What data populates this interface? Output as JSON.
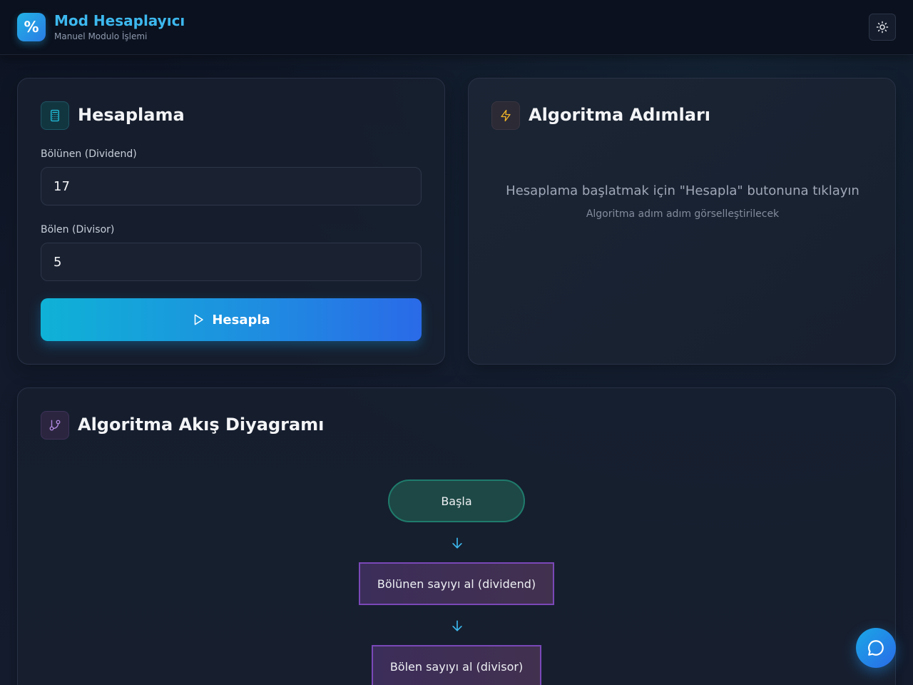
{
  "header": {
    "logo_symbol": "%",
    "title": "Mod Hesaplayıcı",
    "subtitle": "Manuel Modulo İşlemi",
    "theme_toggle_icon": "sun-icon"
  },
  "calculator": {
    "title": "Hesaplama",
    "icon": "calculator-icon",
    "dividend_label": "Bölünen (Dividend)",
    "dividend_value": "17",
    "divisor_label": "Bölen (Divisor)",
    "divisor_value": "5",
    "button_label": "Hesapla",
    "button_icon": "play-icon"
  },
  "steps": {
    "title": "Algoritma Adımları",
    "icon": "lightning-icon",
    "empty_message": "Hesaplama başlatmak için \"Hesapla\" butonuna tıklayın",
    "empty_sub": "Algoritma adım adım görselleştirilecek"
  },
  "flowchart": {
    "title": "Algoritma Akış Diyagramı",
    "icon": "git-branch-icon",
    "nodes": [
      {
        "label": "Başla",
        "type": "start"
      },
      {
        "label": "Bölünen sayıyı al (dividend)",
        "type": "process"
      },
      {
        "label": "Bölen sayıyı al (divisor)",
        "type": "process"
      }
    ]
  },
  "chat": {
    "icon": "chat-bubble-icon"
  },
  "colors": {
    "accent": "#3db8ee",
    "button_gradient_start": "#0fb2d6",
    "button_gradient_end": "#2a6ae8",
    "start_node": "#1d4845",
    "process_node_border": "#7a48b8"
  }
}
